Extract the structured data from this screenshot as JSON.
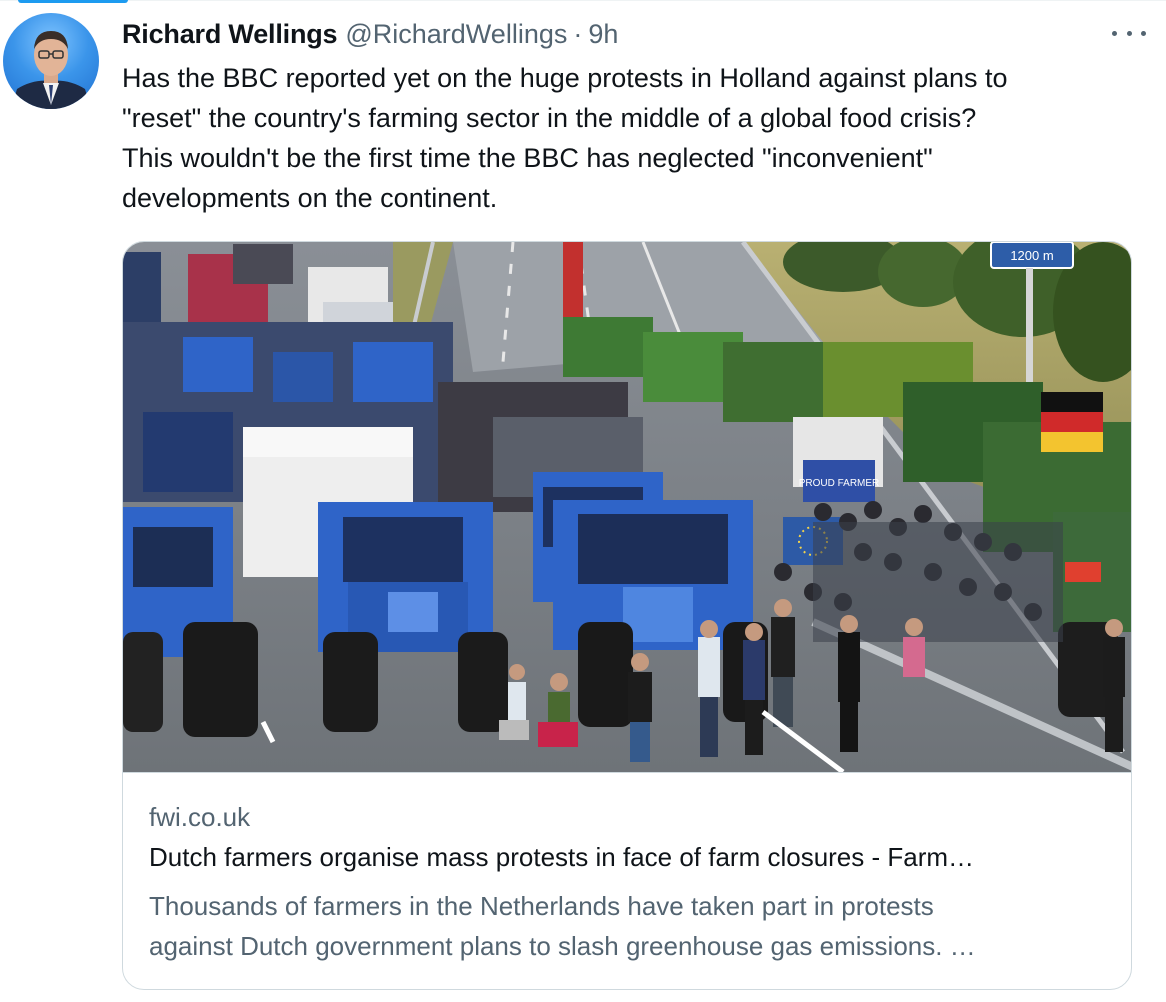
{
  "tweet": {
    "author": {
      "display_name": "Richard Wellings",
      "handle": "@RichardWellings",
      "avatar_icon": "profile-photo"
    },
    "separator": "·",
    "timestamp": "9h",
    "more_icon": "more-horizontal-icon",
    "text_lines": [
      "Has the BBC reported yet on the huge protests in Holland against plans to",
      "\"reset\" the country's farming sector in the middle of a global food crisis?",
      "This wouldn't be the first time the BBC has neglected \"inconvenient\"",
      "developments on the continent."
    ]
  },
  "link_card": {
    "image_alt": "Tractors blocking a motorway during a farmers' protest",
    "image_sign": "1200 m",
    "image_banner": "PROUD FARMER",
    "domain": "fwi.co.uk",
    "title": "Dutch farmers organise mass protests in face of farm closures - Farm…",
    "description_lines": [
      "Thousands of farmers in the Netherlands have taken part in protests",
      "against Dutch government plans to slash greenhouse gas emissions. …"
    ]
  },
  "colors": {
    "text_primary": "#0f1419",
    "text_secondary": "#536471",
    "border": "#cfd9de",
    "accent": "#1d9bf0",
    "tractor_blue": "#2f64c8"
  }
}
